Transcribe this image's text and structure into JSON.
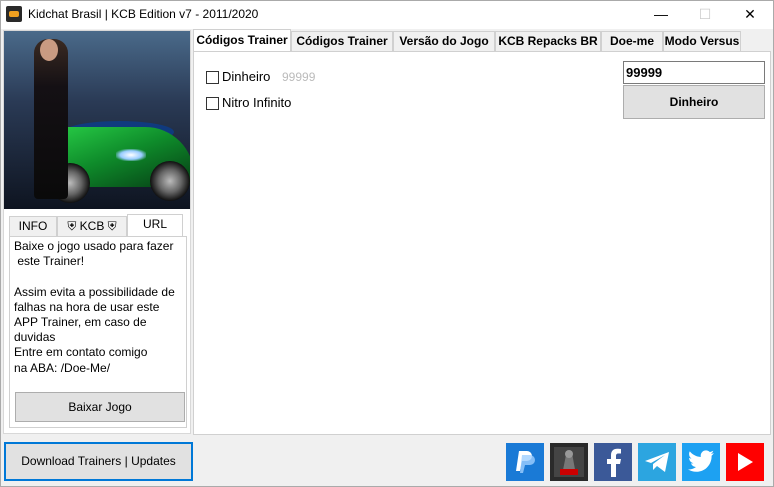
{
  "window": {
    "title": "Kidchat Brasil | KCB Edition v7 - 2011/2020",
    "minimize": "—",
    "maximize": "☐",
    "close": "✕"
  },
  "info_tabs": [
    "INFO",
    "⛨ KCB ⛨",
    "URL"
  ],
  "info_text": "Baixe o jogo usado para fazer\n este Trainer!\n\nAssim evita a possibilidade de\nfalhas na hora de usar este\nAPP Trainer, em caso de duvidas\nEntre em contato comigo\nna ABA: /Doe-Me/",
  "baixar_button": "Baixar Jogo",
  "tabs": [
    "Códigos Trainer",
    "Códigos Trainer",
    "Versão do Jogo",
    "KCB Repacks BR",
    "Doe-me",
    "Modo Versus"
  ],
  "cheats": [
    {
      "label": "Dinheiro",
      "hint": "99999",
      "checked": false
    },
    {
      "label": "Nitro Infinito",
      "hint": "",
      "checked": false
    }
  ],
  "money_input": {
    "value": "99999"
  },
  "money_button": "Dinheiro",
  "download_button": "Download Trainers | Updates",
  "social_icons": [
    "paypal-icon",
    "kcb-repacks-icon",
    "facebook-icon",
    "telegram-icon",
    "twitter-icon",
    "youtube-icon"
  ],
  "colors": {
    "accent": "#0078d7",
    "facebook": "#3b5998",
    "telegram": "#2ca5e0",
    "twitter": "#1da1f2",
    "youtube": "#ff0000",
    "paypal": "#1a7ad6"
  }
}
